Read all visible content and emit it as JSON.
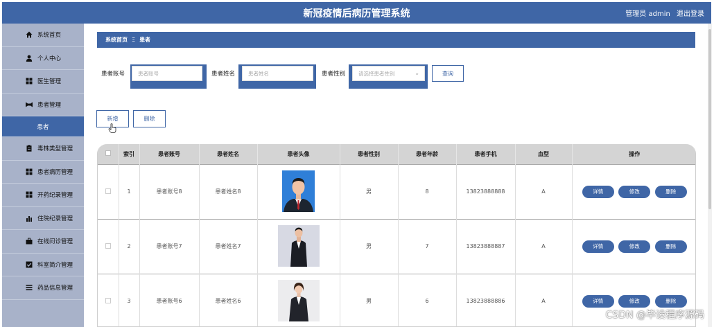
{
  "app": {
    "title": "新冠疫情后病历管理系统",
    "user_label": "管理员 admin",
    "logout_label": "退出登录"
  },
  "sidebar": {
    "items": [
      {
        "label": "系统首页",
        "icon": "home-icon"
      },
      {
        "label": "个人中心",
        "icon": "user-icon"
      },
      {
        "label": "医生管理",
        "icon": "grid-icon"
      },
      {
        "label": "患者管理",
        "icon": "bowtie-icon"
      },
      {
        "label": "患者",
        "active": true
      },
      {
        "label": "毒株类型管理",
        "icon": "clipboard-icon"
      },
      {
        "label": "患者病历管理",
        "icon": "grid-icon"
      },
      {
        "label": "开药纪录管理",
        "icon": "grid-icon"
      },
      {
        "label": "住院纪录管理",
        "icon": "bar-chart-icon"
      },
      {
        "label": "在线问诊管理",
        "icon": "briefcase-icon"
      },
      {
        "label": "科室简介管理",
        "icon": "check-square-icon"
      },
      {
        "label": "药品信息管理",
        "icon": "list-icon"
      }
    ]
  },
  "breadcrumb": {
    "home": "系统首页",
    "separator": "Ξ",
    "current": "患者"
  },
  "filters": {
    "account_label": "患者账号",
    "account_placeholder": "患者账号",
    "name_label": "患者姓名",
    "name_placeholder": "患者姓名",
    "gender_label": "患者性别",
    "gender_placeholder": "请选择患者性别",
    "search_label": "查询"
  },
  "actions": {
    "add_label": "新增",
    "delete_label": "删除"
  },
  "table": {
    "headers": [
      "",
      "索引",
      "患者账号",
      "患者姓名",
      "患者头像",
      "患者性别",
      "患者年龄",
      "患者手机",
      "血型",
      "操作"
    ],
    "rows": [
      {
        "index": "1",
        "account": "患者账号8",
        "name": "患者姓名8",
        "gender": "男",
        "age": "8",
        "phone": "13823888888",
        "blood": "A"
      },
      {
        "index": "2",
        "account": "患者账号7",
        "name": "患者姓名7",
        "gender": "男",
        "age": "7",
        "phone": "13823888887",
        "blood": "A"
      },
      {
        "index": "3",
        "account": "患者账号6",
        "name": "患者姓名6",
        "gender": "男",
        "age": "6",
        "phone": "13823888886",
        "blood": "A"
      }
    ],
    "op_labels": {
      "detail": "详情",
      "edit": "修改",
      "delete": "删除"
    }
  },
  "watermark": "CSDN @毕设程序源码",
  "colors": {
    "primary": "#3f66a6",
    "sidebar": "#a8b2c9"
  }
}
